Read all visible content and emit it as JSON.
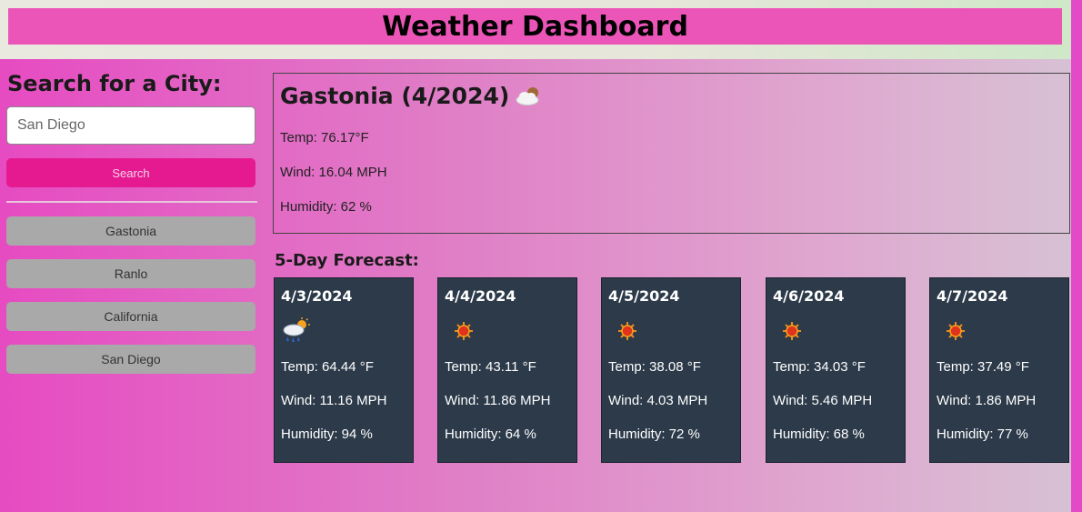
{
  "header": {
    "title": "Weather Dashboard"
  },
  "search": {
    "heading": "Search for a City:",
    "input_value": "San Diego",
    "button_label": "Search"
  },
  "history": [
    {
      "label": "Gastonia"
    },
    {
      "label": "Ranlo"
    },
    {
      "label": "California"
    },
    {
      "label": "San Diego"
    }
  ],
  "current": {
    "title": "Gastonia (4/2024)",
    "icon": "partly-cloudy-icon",
    "temp": "Temp: 76.17°F",
    "wind": "Wind: 16.04 MPH",
    "humidity": "Humidity: 62 %"
  },
  "forecast": {
    "heading": "5-Day Forecast:",
    "days": [
      {
        "date": "4/3/2024",
        "icon": "rain-icon",
        "temp": "Temp: 64.44 °F",
        "wind": "Wind: 11.16 MPH",
        "humidity": "Humidity: 94 %"
      },
      {
        "date": "4/4/2024",
        "icon": "sun-icon",
        "temp": "Temp: 43.11 °F",
        "wind": "Wind: 11.86 MPH",
        "humidity": "Humidity: 64 %"
      },
      {
        "date": "4/5/2024",
        "icon": "sun-icon",
        "temp": "Temp: 38.08 °F",
        "wind": "Wind: 4.03 MPH",
        "humidity": "Humidity: 72 %"
      },
      {
        "date": "4/6/2024",
        "icon": "sun-icon",
        "temp": "Temp: 34.03 °F",
        "wind": "Wind: 5.46 MPH",
        "humidity": "Humidity: 68 %"
      },
      {
        "date": "4/7/2024",
        "icon": "sun-icon",
        "temp": "Temp: 37.49 °F",
        "wind": "Wind: 1.86 MPH",
        "humidity": "Humidity: 77 %"
      }
    ]
  },
  "colors": {
    "title_bar": "#ec55b8",
    "search_button": "#e51a91",
    "history_button": "#a9a9a9",
    "forecast_card": "#2c3a4a"
  }
}
